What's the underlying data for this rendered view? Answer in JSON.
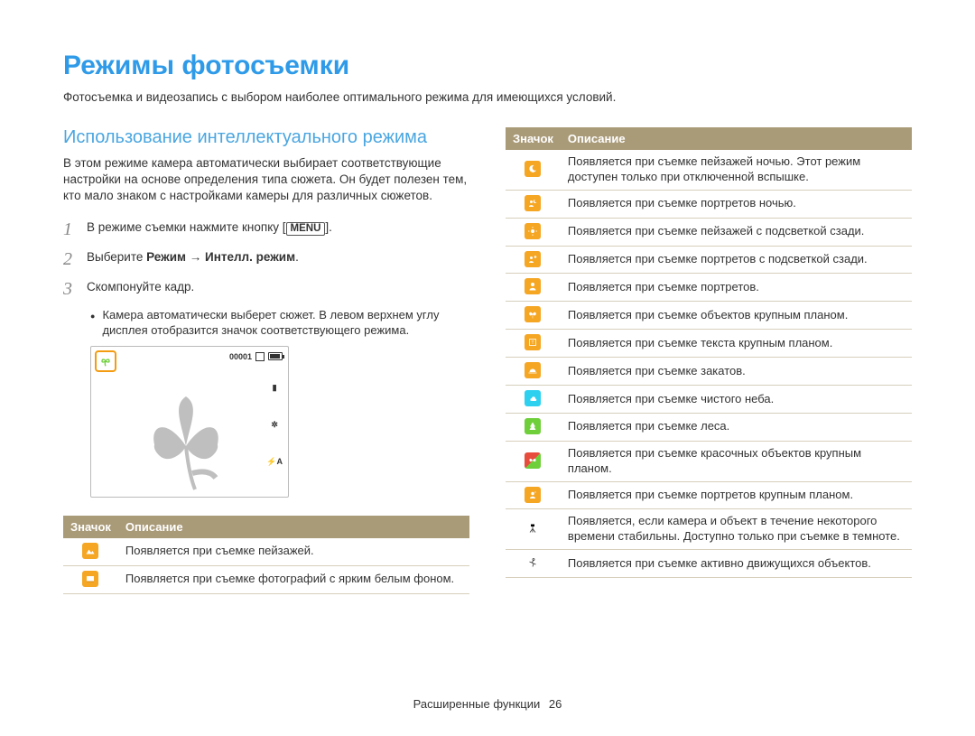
{
  "title": "Режимы фотосъемки",
  "subtitle": "Фотосъемка и видеозапись с выбором наиболее оптимального режима для имеющихся условий.",
  "section_heading": "Использование интеллектуального режима",
  "intro_para": "В этом режиме камера автоматически выбирает соответствующие настройки на основе определения типа сюжета. Он будет полезен тем, кто мало знаком с настройками камеры для различных сюжетов.",
  "steps": {
    "s1_a": "В режиме съемки нажмите кнопку [",
    "s1_menu": "MENU",
    "s1_b": "].",
    "s2_a": "Выберите ",
    "s2_b": "Режим → Интелл. режим",
    "s2_c": ".",
    "s3": "Скомпонуйте кадр.",
    "bullet": "Камера автоматически выберет сюжет. В левом верхнем углу дисплея отобразится значок соответствующего режима."
  },
  "preview": {
    "counter": "00001"
  },
  "table_headers": {
    "icon": "Значок",
    "desc": "Описание"
  },
  "left_table": [
    {
      "icon_color": "orange",
      "icon": "landscape",
      "desc": "Появляется при съемке пейзажей."
    },
    {
      "icon_color": "orange",
      "icon": "whitebg",
      "desc": "Появляется при съемке фотографий с ярким белым фоном."
    }
  ],
  "right_table": [
    {
      "icon_color": "orange",
      "icon": "night",
      "desc": "Появляется при съемке пейзажей ночью. Этот режим доступен только при отключенной вспышке."
    },
    {
      "icon_color": "orange",
      "icon": "night-portrait",
      "desc": "Появляется при съемке портретов ночью."
    },
    {
      "icon_color": "orange",
      "icon": "backlight",
      "desc": "Появляется при съемке пейзажей с подсветкой сзади."
    },
    {
      "icon_color": "orange",
      "icon": "backlight-portrait",
      "desc": "Появляется при съемке портретов с подсветкой сзади."
    },
    {
      "icon_color": "orange",
      "icon": "portrait",
      "desc": "Появляется при съемке портретов."
    },
    {
      "icon_color": "orange",
      "icon": "macro",
      "desc": "Появляется при съемке объектов крупным планом."
    },
    {
      "icon_color": "orange",
      "icon": "macro-text",
      "desc": "Появляется при съемке текста крупным планом."
    },
    {
      "icon_color": "orange",
      "icon": "sunset",
      "desc": "Появляется при съемке закатов."
    },
    {
      "icon_color": "cyan",
      "icon": "sky",
      "desc": "Появляется при съемке чистого неба."
    },
    {
      "icon_color": "green",
      "icon": "forest",
      "desc": "Появляется при съемке леса."
    },
    {
      "icon_color": "redgreen",
      "icon": "color-macro",
      "desc": "Появляется при съемке красочных объектов крупным планом."
    },
    {
      "icon_color": "orange",
      "icon": "macro-portrait",
      "desc": "Появляется при съемке портретов крупным планом."
    },
    {
      "icon_color": "none",
      "icon": "tripod",
      "desc": "Появляется, если камера и объект в течение некоторого времени стабильны. Доступно только при съемке в темноте."
    },
    {
      "icon_color": "none",
      "icon": "action",
      "desc": "Появляется при съемке активно движущихся объектов."
    }
  ],
  "footer": {
    "section": "Расширенные функции",
    "page": "26"
  }
}
